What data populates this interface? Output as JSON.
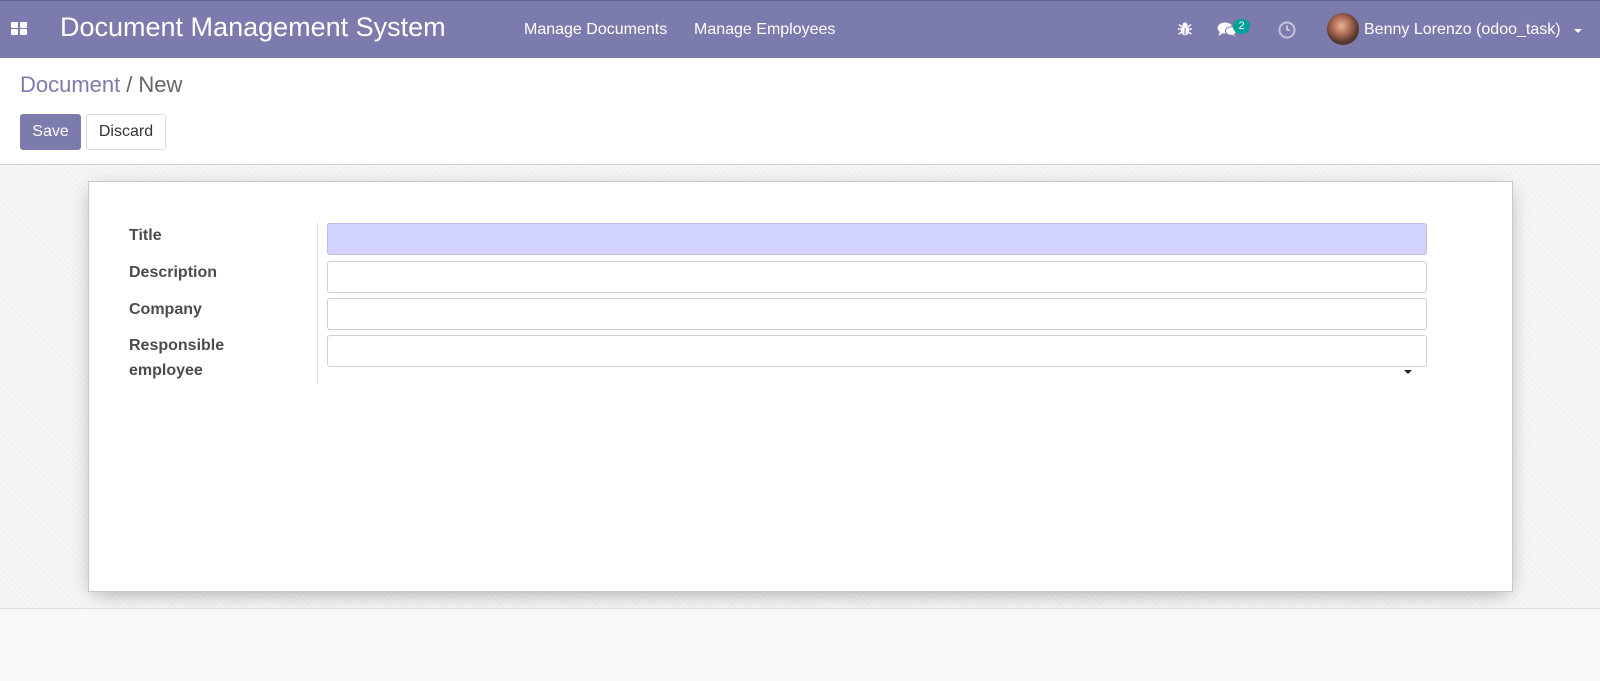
{
  "app": {
    "title": "Document Management System",
    "menu": [
      {
        "label": "Manage Documents"
      },
      {
        "label": "Manage Employees"
      }
    ],
    "systray": {
      "debug_icon": "bug-icon",
      "messaging_icon": "chat-bubbles-icon",
      "messaging_count": "2",
      "activity_icon": "clock-icon"
    },
    "user": {
      "name": "Benny Lorenzo (odoo_task)"
    }
  },
  "breadcrumb": {
    "parent": "Document",
    "separator": "/",
    "current": "New"
  },
  "buttons": {
    "save": "Save",
    "discard": "Discard"
  },
  "form": {
    "fields": [
      {
        "label": "Title",
        "value": "",
        "required": true
      },
      {
        "label": "Description",
        "value": ""
      },
      {
        "label": "Company",
        "value": ""
      },
      {
        "label": "Responsible employee",
        "value": "",
        "type": "select"
      }
    ]
  },
  "colors": {
    "brand": "#7c7bad",
    "badge": "#00a09d",
    "required_field": "#d2d2ff"
  }
}
